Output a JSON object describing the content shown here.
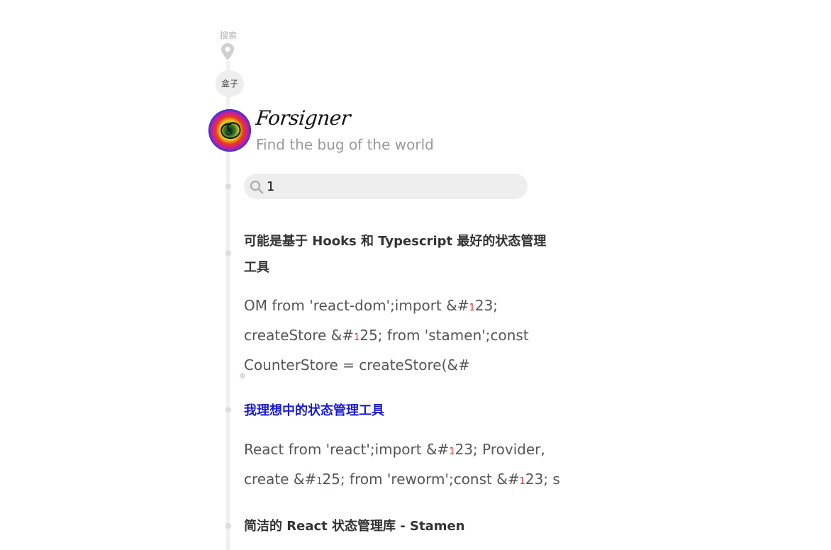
{
  "nav": {
    "search_label": "搜索",
    "box_label": "盒子"
  },
  "header": {
    "brand": "Forsigner",
    "tagline": "Find the bug of the world"
  },
  "search": {
    "value": "1",
    "placeholder": ""
  },
  "results": [
    {
      "title_line1": "可能是基于 Hooks 和 Typescript 最好的状态管理",
      "title_line2": "工具",
      "excerpt": [
        [
          "OM from 'react-dom';import &#",
          "1",
          "23;"
        ],
        [
          "createStore &#",
          "1",
          "25; from 'stamen';const"
        ],
        [
          "CounterStore = createStore(&#"
        ]
      ]
    },
    {
      "title_line1": "我理想中的状态管理工具",
      "excerpt": [
        [
          "React from 'react';import &#",
          "1",
          "23; Provider,"
        ],
        [
          "create &#",
          "1",
          "25; from 'reworm';const &#",
          "1",
          "23; s"
        ]
      ]
    },
    {
      "title_line1": "简洁的 React 状态管理库 - Stamen"
    }
  ],
  "colors": {
    "link": "#1a1ad6",
    "highlight": "#e12525",
    "muted": "#999999"
  }
}
